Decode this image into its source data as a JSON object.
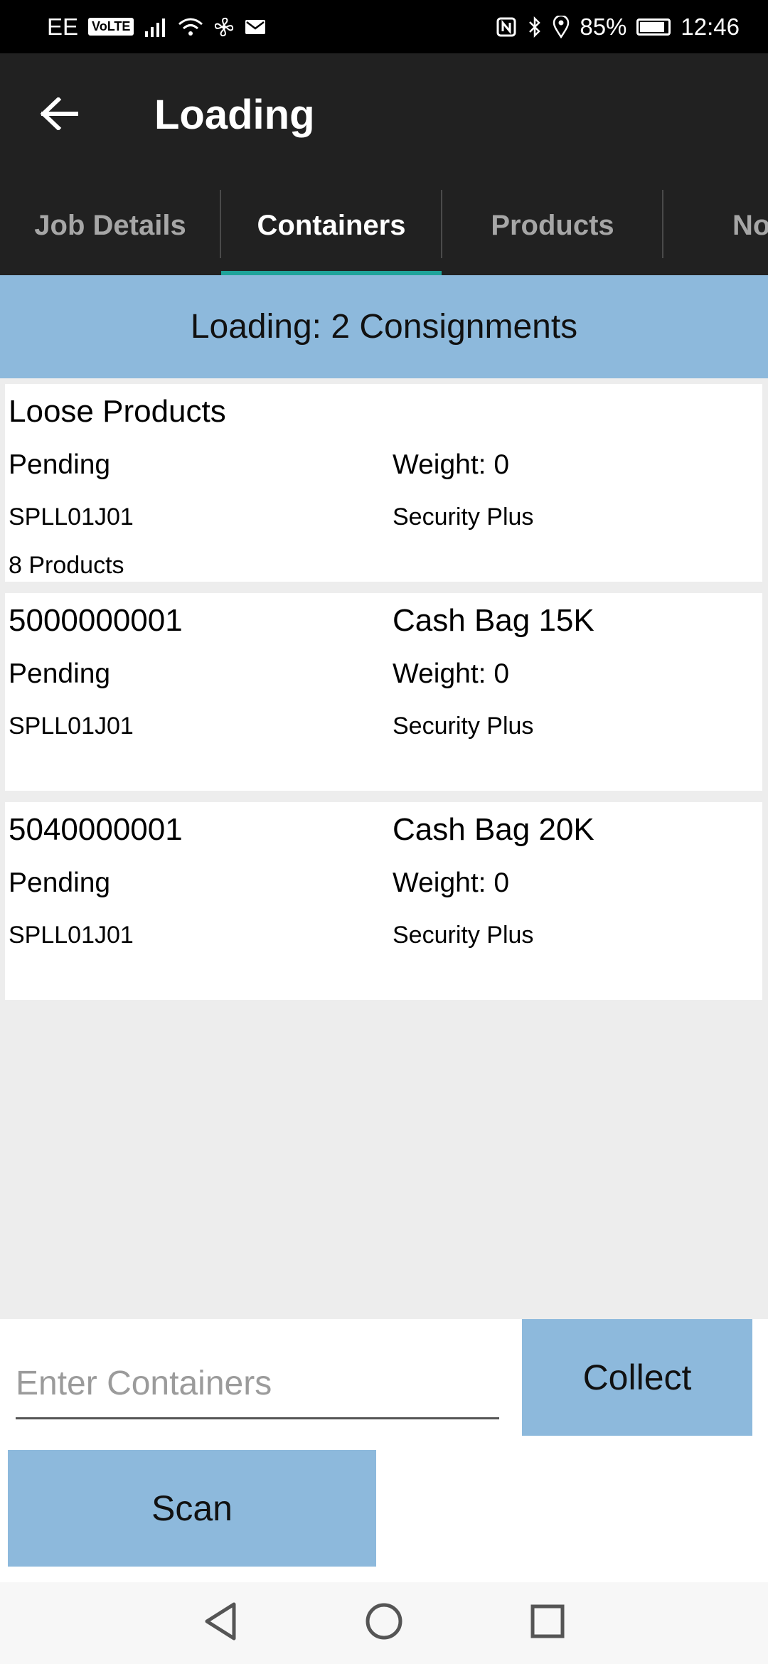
{
  "status_bar": {
    "carrier": "EE",
    "volte": "VoLTE",
    "battery": "85%",
    "time": "12:46"
  },
  "app_bar": {
    "title": "Loading",
    "back_icon": "arrow-left-icon"
  },
  "tabs": [
    {
      "label": "Job Details",
      "active": false
    },
    {
      "label": "Containers",
      "active": true
    },
    {
      "label": "Products",
      "active": false
    },
    {
      "label": "No",
      "active": false
    }
  ],
  "summary": "Loading: 2 Consignments",
  "cards": [
    {
      "title": "Loose Products",
      "right_title": "",
      "status": "Pending",
      "weight": "Weight: 0",
      "code": "SPLL01J01",
      "company": "Security Plus",
      "extra": "8 Products"
    },
    {
      "title": "5000000001",
      "right_title": "Cash Bag 15K",
      "status": "Pending",
      "weight": "Weight: 0",
      "code": "SPLL01J01",
      "company": "Security Plus",
      "extra": ""
    },
    {
      "title": "5040000001",
      "right_title": "Cash Bag 20K",
      "status": "Pending",
      "weight": "Weight: 0",
      "code": "SPLL01J01",
      "company": "Security Plus",
      "extra": ""
    }
  ],
  "input": {
    "placeholder": "Enter Containers",
    "value": ""
  },
  "buttons": {
    "collect": "Collect",
    "scan": "Scan"
  },
  "colors": {
    "app_bar": "#212121",
    "accent": "#1fa39a",
    "button_blue": "#8db9dc",
    "background": "#ededed"
  }
}
